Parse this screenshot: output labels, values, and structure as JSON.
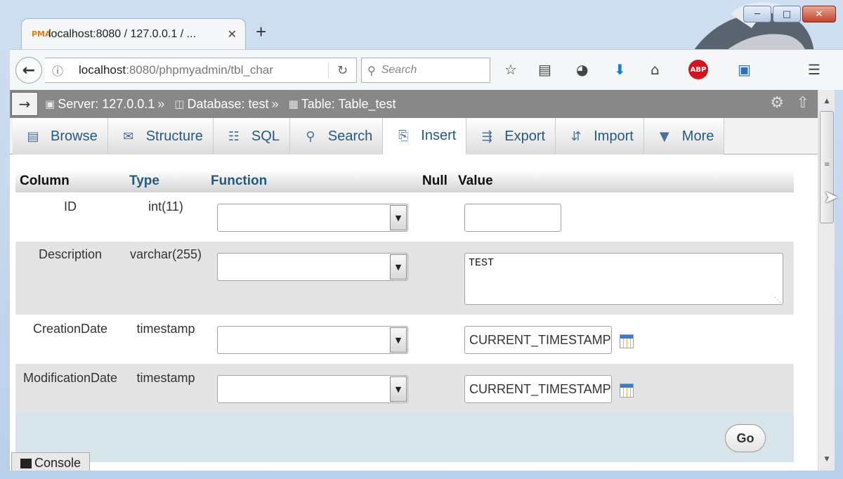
{
  "browser": {
    "tab_title": "localhost:8080 / 127.0.0.1 / ...",
    "tab_favicon": "PMA",
    "url_host": "localhost",
    "url_rest": ":8080/phpmyadmin/tbl_char",
    "search_placeholder": "Search",
    "abp_label": "ABP"
  },
  "breadcrumb": {
    "server": "Server: 127.0.0.1",
    "database": "Database: test",
    "table": "Table: Table_test",
    "sep": "»"
  },
  "tabs": [
    {
      "label": "Browse",
      "icon": "browse-icon"
    },
    {
      "label": "Structure",
      "icon": "structure-icon"
    },
    {
      "label": "SQL",
      "icon": "sql-icon"
    },
    {
      "label": "Search",
      "icon": "search-icon"
    },
    {
      "label": "Insert",
      "icon": "insert-icon"
    },
    {
      "label": "Export",
      "icon": "export-icon"
    },
    {
      "label": "Import",
      "icon": "import-icon"
    },
    {
      "label": "More",
      "icon": "more-icon"
    }
  ],
  "active_tab": "Insert",
  "headers": {
    "column": "Column",
    "type": "Type",
    "function": "Function",
    "null": "Null",
    "value": "Value"
  },
  "rows": [
    {
      "column": "ID",
      "type": "int(11)",
      "function": "",
      "value": ""
    },
    {
      "column": "Description",
      "type": "varchar(255)",
      "function": "",
      "value": "TEST"
    },
    {
      "column": "CreationDate",
      "type": "timestamp",
      "function": "",
      "value": "CURRENT_TIMESTAMP"
    },
    {
      "column": "ModificationDate",
      "type": "timestamp",
      "function": "",
      "value": "CURRENT_TIMESTAMP"
    }
  ],
  "go_label": "Go",
  "console_label": "Console",
  "colors": {
    "link": "#235a81",
    "topbar": "#888888",
    "row_alt": "#e4e4e4",
    "gobar": "#d7e4ea"
  }
}
